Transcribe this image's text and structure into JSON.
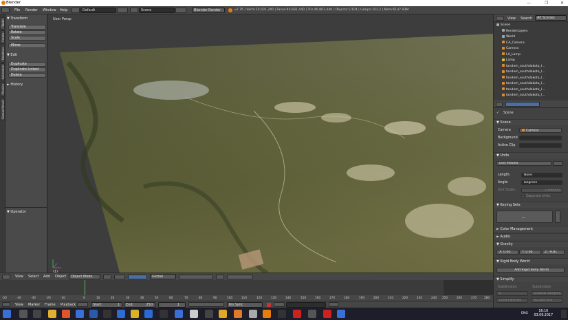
{
  "window": {
    "title": "Blender",
    "controls": [
      "—",
      "❐",
      "✕"
    ]
  },
  "menubar": {
    "items": [
      "File",
      "Render",
      "Window",
      "Help"
    ],
    "layout": "Default",
    "scene": "Scene",
    "engine": "Blender Render",
    "stats": "v2.76 | Verts:20,501,240 | Faces:40,681,440 | Tris:40,861,440 | Objects:1/104 | Lamps:1/112 | Mem:6147.93M"
  },
  "tooltabs": [
    "Tools",
    "Create",
    "Relations",
    "Animation",
    "Physics",
    "Grease Pencil"
  ],
  "toolshelf": {
    "transform_header": "▼ Transform",
    "transform": [
      "Translate",
      "Rotate",
      "Scale",
      "Mirror"
    ],
    "edit_header": "▼ Edit",
    "edit": [
      "Duplicate",
      "Duplicate Linked",
      "Delete"
    ],
    "history": "► History",
    "operator": "▼ Operator"
  },
  "viewport": {
    "label": "User Persp",
    "frame": "(1)"
  },
  "viewport_header": {
    "items": [
      "View",
      "Select",
      "Add",
      "Object"
    ],
    "mode": "Object Mode",
    "orientation": "Global"
  },
  "timeline": {
    "ticks": [
      "-50",
      "-40",
      "-30",
      "-20",
      "-10",
      "0",
      "10",
      "20",
      "30",
      "40",
      "50",
      "60",
      "70",
      "80",
      "90",
      "100",
      "110",
      "120",
      "130",
      "140",
      "150",
      "160",
      "170",
      "180",
      "190",
      "200",
      "210",
      "220",
      "230",
      "240",
      "250",
      "260",
      "270",
      "280"
    ]
  },
  "timeline_header": {
    "items": [
      "View",
      "Marker",
      "Frame",
      "Playback"
    ],
    "start_label": "Start:",
    "start": "1",
    "end_label": "End:",
    "end": "250",
    "current": "1",
    "sync": "No Sync"
  },
  "outliner": {
    "view": "View",
    "search": "Search",
    "filter": "All Scenes",
    "items": [
      "Scene",
      "RenderLayers",
      "World",
      "CA_Camera",
      "Camera",
      "LA_Lamp",
      "Lamp",
      "tandem_southdakota_l...",
      "tandem_southdakota_l...",
      "tandem_southdakota_l...",
      "tandem_southdakota_l...",
      "tandem_southdakota_l...",
      "tandem_southdakota_l..."
    ]
  },
  "props": {
    "scene_name": "Scene",
    "scene_panel": "▼ Scene",
    "camera_label": "Camera",
    "camera_value": "Camera",
    "background_label": "Background",
    "activeclip_label": "Active Clip",
    "units_panel": "▼ Units",
    "unit_presets": "Unit Presets",
    "length_label": "Length:",
    "length_value": "None",
    "angle_label": "Angle:",
    "angle_value": "Degrees",
    "unit_scale_label": "Unit Scale:",
    "unit_scale_value": "1.000000",
    "separate_units": "Separate Units",
    "keying_panel": "▼ Keying Sets",
    "keying_list_value": "__",
    "color_mgmt": "► Color Management",
    "audio": "► Audio",
    "gravity": "▼ Gravity",
    "gx": "X: 0.00",
    "gy": "Y: 0.00",
    "gz": "Z: -9.81",
    "rigid_panel": "▼ Rigid Body World",
    "rigid_button": "Add Rigid Body World",
    "simplify": "▼ Simplify",
    "subdiv_label": "Subdivision",
    "subdiv_value": "6",
    "child_label": "Child Particles",
    "child_value": "1.000",
    "subdiv2_label": "Subdivision",
    "shadow_label": "Shadow Samples",
    "ao_label": "AO and SSS",
    "ao_value": "1.000"
  },
  "taskbar": {
    "time": "16:10",
    "date": "03.09.2017",
    "lang": "ENG"
  }
}
